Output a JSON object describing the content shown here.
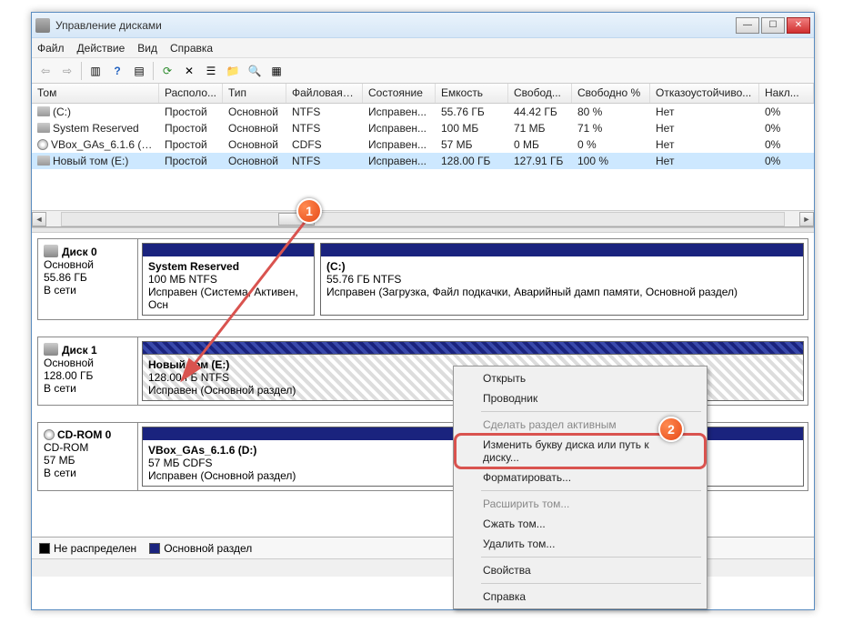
{
  "window": {
    "title": "Управление дисками"
  },
  "menu": {
    "file": "Файл",
    "action": "Действие",
    "view": "Вид",
    "help": "Справка"
  },
  "columns": {
    "vol": "Том",
    "layout": "Располо...",
    "type": "Тип",
    "fs": "Файловая с...",
    "status": "Состояние",
    "capacity": "Емкость",
    "free": "Свобод...",
    "freepct": "Свободно %",
    "fault": "Отказоустойчиво...",
    "overhead": "Накл..."
  },
  "volumes": [
    {
      "name": "(C:)",
      "layout": "Простой",
      "type": "Основной",
      "fs": "NTFS",
      "status": "Исправен...",
      "cap": "55.76 ГБ",
      "free": "44.42 ГБ",
      "pct": "80 %",
      "fault": "Нет",
      "ov": "0%",
      "icon": "vol"
    },
    {
      "name": "System Reserved",
      "layout": "Простой",
      "type": "Основной",
      "fs": "NTFS",
      "status": "Исправен...",
      "cap": "100 МБ",
      "free": "71 МБ",
      "pct": "71 %",
      "fault": "Нет",
      "ov": "0%",
      "icon": "vol"
    },
    {
      "name": "VBox_GAs_6.1.6 (D:)",
      "layout": "Простой",
      "type": "Основной",
      "fs": "CDFS",
      "status": "Исправен...",
      "cap": "57 МБ",
      "free": "0 МБ",
      "pct": "0 %",
      "fault": "Нет",
      "ov": "0%",
      "icon": "cd"
    },
    {
      "name": "Новый том (E:)",
      "layout": "Простой",
      "type": "Основной",
      "fs": "NTFS",
      "status": "Исправен...",
      "cap": "128.00 ГБ",
      "free": "127.91 ГБ",
      "pct": "100 %",
      "fault": "Нет",
      "ov": "0%",
      "icon": "vol",
      "selected": true
    }
  ],
  "disks": {
    "d0": {
      "name": "Диск 0",
      "type": "Основной",
      "size": "55.86 ГБ",
      "state": "В сети",
      "p1": {
        "name": "System Reserved",
        "line2": "100 МБ NTFS",
        "line3": "Исправен (Система, Активен, Осн"
      },
      "p2": {
        "name": "(C:)",
        "line2": "55.76 ГБ NTFS",
        "line3": "Исправен (Загрузка, Файл подкачки, Аварийный дамп памяти, Основной раздел)"
      }
    },
    "d1": {
      "name": "Диск 1",
      "type": "Основной",
      "size": "128.00 ГБ",
      "state": "В сети",
      "p1": {
        "name": "Новый том  (E:)",
        "line2": "128.00 ГБ NTFS",
        "line3": "Исправен (Основной раздел)"
      }
    },
    "cd0": {
      "name": "CD-ROM 0",
      "type": "CD-ROM",
      "size": "57 МБ",
      "state": "В сети",
      "p1": {
        "name": "VBox_GAs_6.1.6  (D:)",
        "line2": "57 МБ CDFS",
        "line3": "Исправен (Основной раздел)"
      }
    }
  },
  "legend": {
    "unalloc": "Не распределен",
    "primary": "Основной раздел"
  },
  "ctx": {
    "open": "Открыть",
    "explorer": "Проводник",
    "active": "Сделать раздел активным",
    "changeletter": "Изменить букву диска или путь к диску...",
    "format": "Форматировать...",
    "extend": "Расширить том...",
    "shrink": "Сжать том...",
    "delete": "Удалить том...",
    "props": "Свойства",
    "help": "Справка"
  },
  "badges": {
    "b1": "1",
    "b2": "2"
  }
}
